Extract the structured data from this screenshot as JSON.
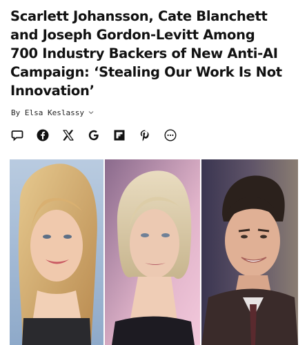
{
  "article": {
    "headline_lines": [
      "Scarlett Johansson, Cate Blanchett",
      "and Joseph Gordon-Levitt Among",
      "700 Industry Backers of New Anti-AI",
      "Campaign: ‘Stealing Our Work Is Not",
      "Innovation’"
    ],
    "byline": "By Elsa Keslassy",
    "byline_chevron_icon": "chevron-down-icon"
  },
  "share": {
    "icons": [
      "comment-icon",
      "facebook-icon",
      "x-icon",
      "google-icon",
      "flipboard-icon",
      "pinterest-icon",
      "more-icon"
    ]
  },
  "photos": {
    "subjects": [
      "Scarlett Johansson",
      "Cate Blanchett",
      "Joseph Gordon-Levitt"
    ]
  },
  "colors": {
    "text": "#111111",
    "muted": "#777777"
  }
}
